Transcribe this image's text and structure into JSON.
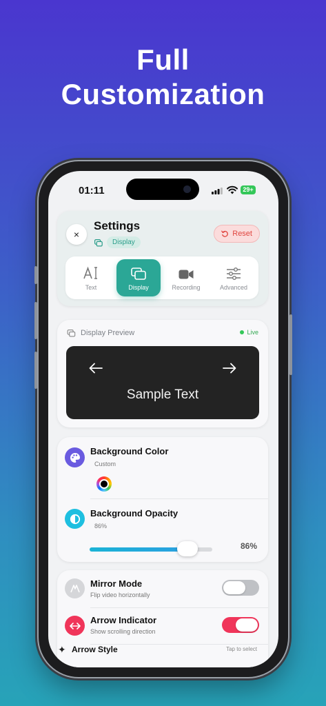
{
  "headline": {
    "line1": "Full",
    "line2": "Customization"
  },
  "status_bar": {
    "time": "01:11",
    "battery": "29+"
  },
  "header": {
    "title": "Settings",
    "breadcrumb": "Display",
    "reset_label": "Reset",
    "close_glyph": "×"
  },
  "tabs": [
    {
      "label": "Text",
      "icon": "text-cursor-icon",
      "active": false
    },
    {
      "label": "Display",
      "icon": "display-icon",
      "active": true
    },
    {
      "label": "Recording",
      "icon": "video-camera-icon",
      "active": false
    },
    {
      "label": "Advanced",
      "icon": "sliders-icon",
      "active": false
    }
  ],
  "preview": {
    "heading": "Display Preview",
    "live_label": "Live",
    "sample_text": "Sample Text"
  },
  "background": {
    "color_title": "Background Color",
    "color_sub": "Custom",
    "color_value": "#000000",
    "opacity_title": "Background Opacity",
    "opacity_sub": "86%",
    "opacity_value_label": "86%",
    "opacity_fraction": 0.86
  },
  "toggles": {
    "mirror": {
      "title": "Mirror Mode",
      "sub": "Flip video horizontally",
      "on": false
    },
    "arrow": {
      "title": "Arrow Indicator",
      "sub": "Show scrolling direction",
      "on": true
    }
  },
  "arrow_style": {
    "title": "Arrow Style",
    "hint": "Tap to select"
  },
  "colors": {
    "accent": "#2ba796",
    "danger": "#f0355a",
    "slider": "#1bb3d6"
  }
}
